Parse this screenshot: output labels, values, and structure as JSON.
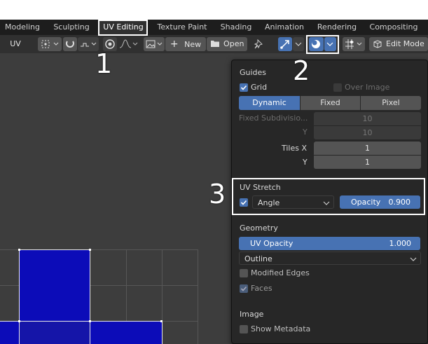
{
  "workspace_tabs": [
    "Modeling",
    "Sculpting",
    "UV Editing",
    "Texture Paint",
    "Shading",
    "Animation",
    "Rendering",
    "Compositing"
  ],
  "header": {
    "editor_label": "UV",
    "new_label": "New",
    "open_label": "Open",
    "mode_label": "Edit Mode"
  },
  "callouts": [
    "1",
    "2",
    "3"
  ],
  "overlays": {
    "guides_header": "Guides",
    "grid_label": "Grid",
    "over_image_label": "Over Image",
    "grid_modes": [
      "Dynamic",
      "Fixed",
      "Pixel"
    ],
    "fixed_subdiv_label": "Fixed Subdivisio...",
    "fixed_subdiv_x": "10",
    "fixed_subdiv_y_label": "Y",
    "fixed_subdiv_y": "10",
    "tiles_x_label": "Tiles X",
    "tiles_x": "1",
    "tiles_y_label": "Y",
    "tiles_y": "1",
    "uv_stretch_header": "UV Stretch",
    "stretch_mode": "Angle",
    "opacity_label": "Opacity",
    "opacity_value": "0.900",
    "geometry_header": "Geometry",
    "uv_opacity_label": "UV Opacity",
    "uv_opacity_value": "1.000",
    "edge_display": "Outline",
    "modified_edges_label": "Modified Edges",
    "faces_label": "Faces",
    "image_header": "Image",
    "show_metadata_label": "Show Metadata"
  },
  "colors": {
    "accent": "#4772b3",
    "uv_face": "#0c0cb8"
  }
}
